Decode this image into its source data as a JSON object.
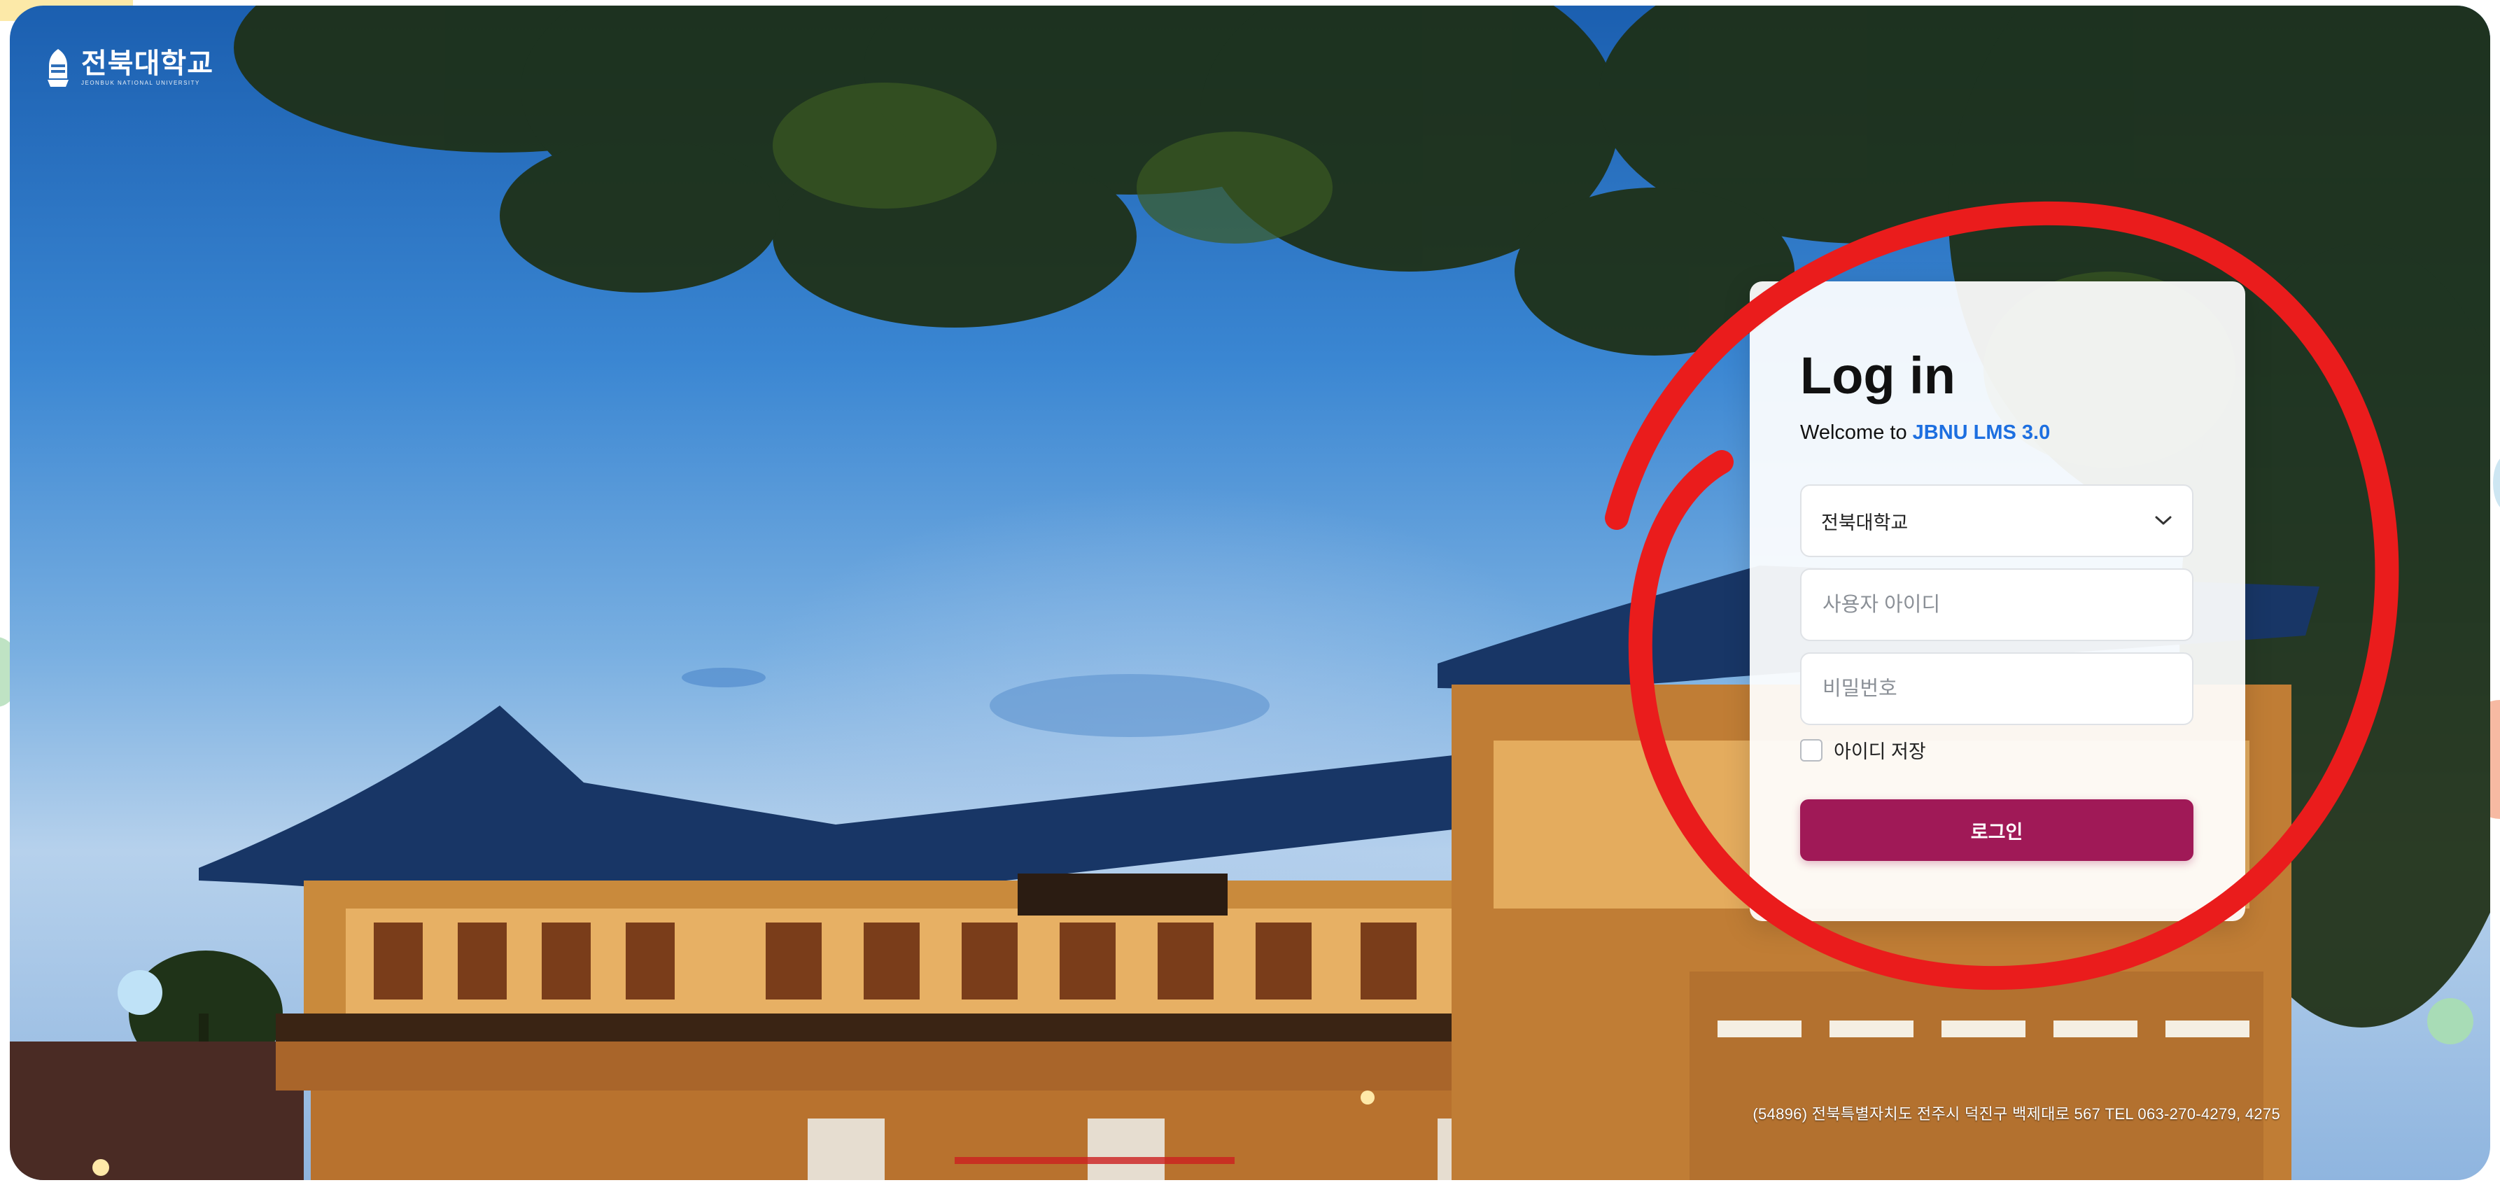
{
  "brand": {
    "logo_ko": "전북대학교",
    "logo_en": "JEONBUK NATIONAL UNIVERSITY"
  },
  "login": {
    "title": "Log in",
    "welcome_prefix": "Welcome to ",
    "welcome_brand": "JBNU LMS 3.0",
    "school_select": {
      "selected": "전북대학교"
    },
    "user_id": {
      "placeholder": "사용자 아이디",
      "value": ""
    },
    "password": {
      "placeholder": "비밀번호",
      "value": ""
    },
    "remember_label": "아이디 저장",
    "remember_checked": false,
    "submit_label": "로그인"
  },
  "footer": {
    "address": "(54896) 전북특별자치도 전주시 덕진구 백제대로 567 TEL 063-270-4279, 4275"
  },
  "colors": {
    "brand_link": "#1d6fe0",
    "login_button": "#a01957",
    "highlight_ring": "#ea1c1c"
  },
  "icons": {
    "logo": "university-emblem-icon",
    "select": "chevron-down-icon",
    "remember": "checkbox-icon"
  }
}
